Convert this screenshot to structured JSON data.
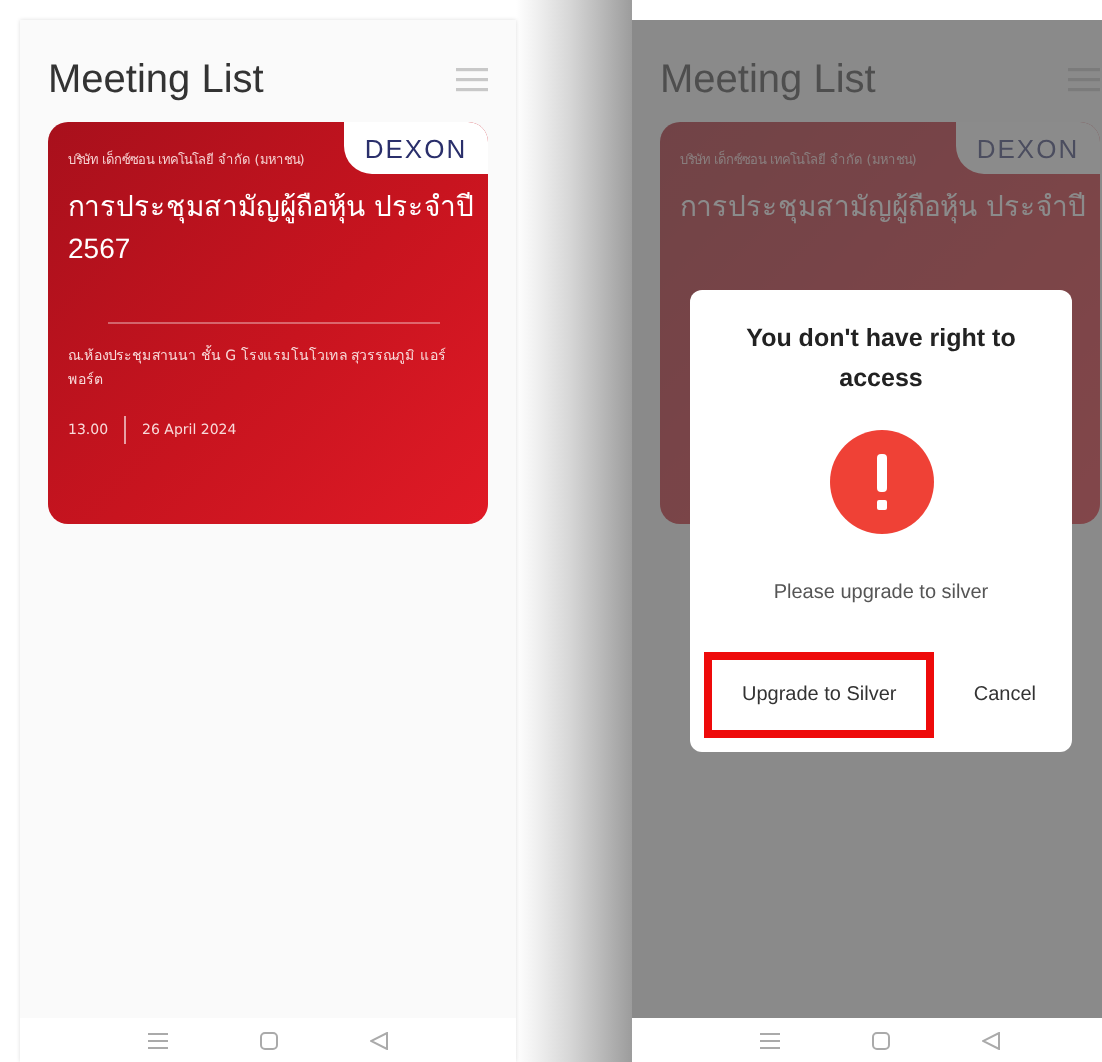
{
  "screens": [
    {
      "kind": "list",
      "title": "Meeting List",
      "card": {
        "logo": "DEXON",
        "company": "บริษัท เด็กซ์ซอน เทคโนโลยี จำกัด (มหาชน)",
        "title_lines": [
          "การประชุมสามัญผู้ถือหุ้น ประจำปี",
          "2567"
        ],
        "location": "ณ.ห้องประชุมสานนา ชั้น G โรงแรมโนโวเทล สุวรรณภูมิ แอร์พอร์ต",
        "time": "13.00",
        "date": "26 April 2024"
      }
    },
    {
      "kind": "dialog",
      "title": "Meeting List",
      "card": {
        "logo": "DEXON",
        "company": "บริษัท เด็กซ์ซอน เทคโนโลยี จำกัด (มหาชน)",
        "title_lines": [
          "การประชุมสามัญผู้ถือหุ้น ประจำปี"
        ]
      },
      "dialog": {
        "title": "You don't have right to access",
        "message": "Please upgrade to silver",
        "buttons": [
          {
            "label": "Upgrade to Silver",
            "highlighted": true
          },
          {
            "label": "Cancel",
            "highlighted": false
          }
        ]
      }
    }
  ]
}
